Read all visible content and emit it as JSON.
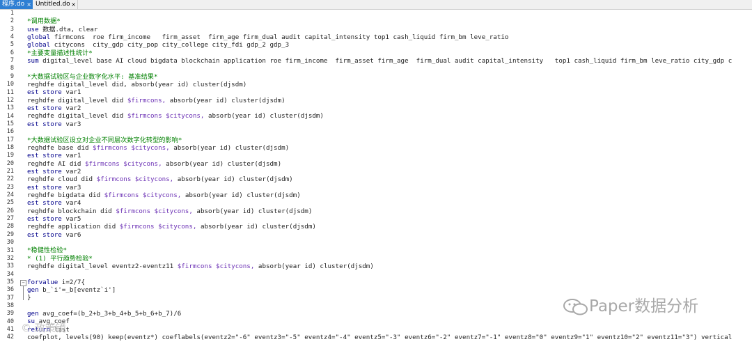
{
  "tabs": [
    {
      "label": "程序.do",
      "close": "×",
      "active": true
    },
    {
      "label": "Untitled.do",
      "close": "×",
      "active": false
    }
  ],
  "lines": [
    {
      "n": "1",
      "segs": []
    },
    {
      "n": "2",
      "segs": [
        {
          "t": "c",
          "s": "*调用数据*"
        }
      ]
    },
    {
      "n": "3",
      "segs": [
        {
          "t": "k",
          "s": "use"
        },
        {
          "t": "t",
          "s": " 数据.dta, clear"
        }
      ]
    },
    {
      "n": "4",
      "segs": [
        {
          "t": "k",
          "s": "global"
        },
        {
          "t": "t",
          "s": " firmcons  roe firm_income   firm_asset  firm_age firm_dual audit capital_intensity top1 cash_liquid firm_bm leve_ratio"
        }
      ]
    },
    {
      "n": "5",
      "segs": [
        {
          "t": "k",
          "s": "global"
        },
        {
          "t": "t",
          "s": " citycons  city_gdp city_pop city_college city_fdi gdp_2 gdp_3"
        }
      ]
    },
    {
      "n": "6",
      "segs": [
        {
          "t": "c",
          "s": "*主要变量描述性统计*"
        }
      ]
    },
    {
      "n": "7",
      "segs": [
        {
          "t": "k",
          "s": "sum"
        },
        {
          "t": "t",
          "s": " digital_level base AI cloud bigdata blockchain application roe firm_income  firm_asset firm_age  firm_dual audit capital_intensity   top1 cash_liquid firm_bm leve_ratio city_gdp c"
        }
      ]
    },
    {
      "n": "8",
      "segs": []
    },
    {
      "n": "9",
      "segs": [
        {
          "t": "c",
          "s": "*大数据试验区与企业数字化水平: 基准结果*"
        }
      ]
    },
    {
      "n": "10",
      "segs": [
        {
          "t": "t",
          "s": "reghdfe digital_level did, absorb(year id) cluster(djsdm)"
        }
      ]
    },
    {
      "n": "11",
      "segs": [
        {
          "t": "k",
          "s": "est store"
        },
        {
          "t": "t",
          "s": " var1"
        }
      ]
    },
    {
      "n": "12",
      "segs": [
        {
          "t": "t",
          "s": "reghdfe digital_level did "
        },
        {
          "t": "m",
          "s": "$firmcons,"
        },
        {
          "t": "t",
          "s": " absorb(year id) cluster(djsdm)"
        }
      ]
    },
    {
      "n": "13",
      "segs": [
        {
          "t": "k",
          "s": "est store"
        },
        {
          "t": "t",
          "s": " var2"
        }
      ]
    },
    {
      "n": "14",
      "segs": [
        {
          "t": "t",
          "s": "reghdfe digital_level did "
        },
        {
          "t": "m",
          "s": "$firmcons $citycons,"
        },
        {
          "t": "t",
          "s": " absorb(year id) cluster(djsdm)"
        }
      ]
    },
    {
      "n": "15",
      "segs": [
        {
          "t": "k",
          "s": "est store"
        },
        {
          "t": "t",
          "s": " var3"
        }
      ]
    },
    {
      "n": "16",
      "segs": []
    },
    {
      "n": "17",
      "segs": [
        {
          "t": "c",
          "s": "*大数据试验区设立对企业不同层次数字化转型的影响*"
        }
      ]
    },
    {
      "n": "18",
      "segs": [
        {
          "t": "t",
          "s": "reghdfe base did "
        },
        {
          "t": "m",
          "s": "$firmcons $citycons,"
        },
        {
          "t": "t",
          "s": " absorb(year id) cluster(djsdm)"
        }
      ]
    },
    {
      "n": "19",
      "segs": [
        {
          "t": "k",
          "s": "est store"
        },
        {
          "t": "t",
          "s": " var1"
        }
      ]
    },
    {
      "n": "20",
      "segs": [
        {
          "t": "t",
          "s": "reghdfe AI did "
        },
        {
          "t": "m",
          "s": "$firmcons $citycons,"
        },
        {
          "t": "t",
          "s": " absorb(year id) cluster(djsdm)"
        }
      ]
    },
    {
      "n": "21",
      "segs": [
        {
          "t": "k",
          "s": "est store"
        },
        {
          "t": "t",
          "s": " var2"
        }
      ]
    },
    {
      "n": "22",
      "segs": [
        {
          "t": "t",
          "s": "reghdfe cloud did "
        },
        {
          "t": "m",
          "s": "$firmcons $citycons,"
        },
        {
          "t": "t",
          "s": " absorb(year id) cluster(djsdm)"
        }
      ]
    },
    {
      "n": "23",
      "segs": [
        {
          "t": "k",
          "s": "est store"
        },
        {
          "t": "t",
          "s": " var3"
        }
      ]
    },
    {
      "n": "24",
      "segs": [
        {
          "t": "t",
          "s": "reghdfe bigdata did "
        },
        {
          "t": "m",
          "s": "$firmcons $citycons,"
        },
        {
          "t": "t",
          "s": " absorb(year id) cluster(djsdm)"
        }
      ]
    },
    {
      "n": "25",
      "segs": [
        {
          "t": "k",
          "s": "est store"
        },
        {
          "t": "t",
          "s": " var4"
        }
      ]
    },
    {
      "n": "26",
      "segs": [
        {
          "t": "t",
          "s": "reghdfe blockchain did "
        },
        {
          "t": "m",
          "s": "$firmcons $citycons,"
        },
        {
          "t": "t",
          "s": " absorb(year id) cluster(djsdm)"
        }
      ]
    },
    {
      "n": "27",
      "segs": [
        {
          "t": "k",
          "s": "est store"
        },
        {
          "t": "t",
          "s": " var5"
        }
      ]
    },
    {
      "n": "28",
      "segs": [
        {
          "t": "t",
          "s": "reghdfe application did "
        },
        {
          "t": "m",
          "s": "$firmcons $citycons,"
        },
        {
          "t": "t",
          "s": " absorb(year id) cluster(djsdm)"
        }
      ]
    },
    {
      "n": "29",
      "segs": [
        {
          "t": "k",
          "s": "est store"
        },
        {
          "t": "t",
          "s": " var6"
        }
      ]
    },
    {
      "n": "30",
      "segs": []
    },
    {
      "n": "31",
      "segs": [
        {
          "t": "c",
          "s": "*稳健性检验*"
        }
      ]
    },
    {
      "n": "32",
      "segs": [
        {
          "t": "c",
          "s": "* (1) 平行趋势检验*"
        }
      ]
    },
    {
      "n": "33",
      "segs": [
        {
          "t": "t",
          "s": "reghdfe digital_level eventz2-eventz11 "
        },
        {
          "t": "m",
          "s": "$firmcons $citycons,"
        },
        {
          "t": "t",
          "s": " absorb(year id) cluster(djsdm)"
        }
      ]
    },
    {
      "n": "34",
      "segs": []
    },
    {
      "n": "35",
      "segs": [
        {
          "t": "k",
          "s": "forvalue"
        },
        {
          "t": "t",
          "s": " i=2/7{"
        }
      ]
    },
    {
      "n": "36",
      "segs": [
        {
          "t": "k",
          "s": "gen"
        },
        {
          "t": "t",
          "s": " b_`i'=_b[eventz`i']"
        }
      ]
    },
    {
      "n": "37",
      "segs": [
        {
          "t": "t",
          "s": "}"
        }
      ]
    },
    {
      "n": "38",
      "segs": []
    },
    {
      "n": "39",
      "segs": [
        {
          "t": "k",
          "s": "gen"
        },
        {
          "t": "t",
          "s": " avg_coef=(b_2+b_3+b_4+b_5+b_6+b_7)/6"
        }
      ]
    },
    {
      "n": "40",
      "segs": [
        {
          "t": "k",
          "s": "su"
        },
        {
          "t": "t",
          "s": " avg_coef"
        }
      ]
    },
    {
      "n": "41",
      "segs": [
        {
          "t": "k",
          "s": "return"
        },
        {
          "t": "t",
          "s": " list"
        }
      ]
    },
    {
      "n": "42",
      "segs": [
        {
          "t": "t",
          "s": "coefplot, levels(90) keep(eventz*) coeflabels(eventz2=\"-6\" eventz3=\"-5\" eventz4=\"-4\" eventz5=\"-3\" eventz6=\"-2\" eventz7=\"-1\" eventz8=\"0\" eventz9=\"1\" eventz10=\"2\" eventz11=\"3\") vertical"
        }
      ]
    }
  ],
  "watermark": "Paper数据分析",
  "watermark2": "© 政策镜",
  "colors": {
    "tab_active_bg": "#2f7fd3",
    "comment": "#008000",
    "keyword": "#00008b",
    "macro": "#6a2fb4"
  }
}
